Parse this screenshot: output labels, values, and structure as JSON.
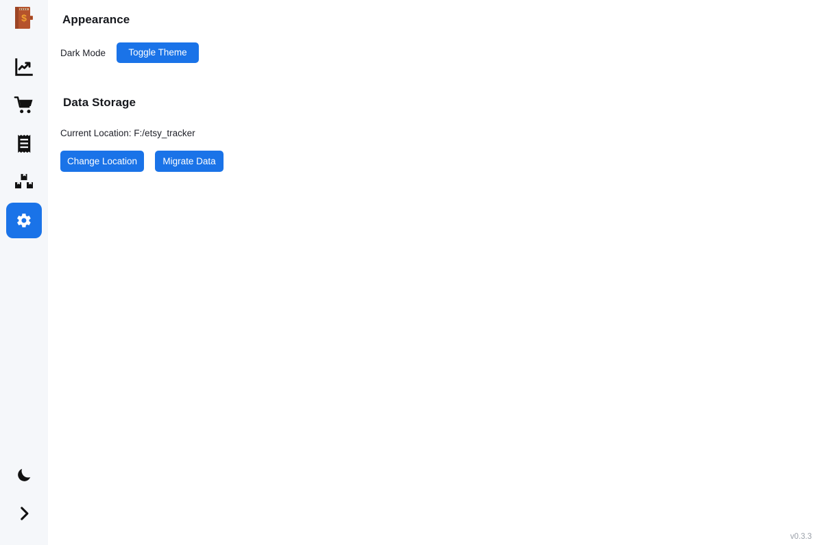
{
  "app": {
    "version_label": "v0.3.3",
    "accent_color": "#1a73e8",
    "sidebar_bg": "#f5f7fa",
    "main_bg": "#ffffff"
  },
  "sidebar": {
    "logo": {
      "icon": "ledger-dollar-icon",
      "alt": "Etsy Tracker logo"
    },
    "items": [
      {
        "icon": "analytics-chart-icon",
        "label": "Analytics",
        "active": false
      },
      {
        "icon": "shopping-cart-icon",
        "label": "Orders",
        "active": false
      },
      {
        "icon": "receipt-icon",
        "label": "Expenses",
        "active": false
      },
      {
        "icon": "boxes-inventory-icon",
        "label": "Inventory",
        "active": false
      },
      {
        "icon": "gear-icon",
        "label": "Settings",
        "active": true
      }
    ],
    "bottom_items": [
      {
        "icon": "moon-icon",
        "label": "Dark mode toggle"
      },
      {
        "icon": "chevron-right-icon",
        "label": "Expand sidebar"
      }
    ]
  },
  "main": {
    "appearance": {
      "title": "Appearance",
      "dark_mode_label": "Dark Mode",
      "toggle_theme_label": "Toggle Theme"
    },
    "data_storage": {
      "title": "Data Storage",
      "current_location_text": "Current Location: F:/etsy_tracker",
      "change_location_label": "Change Location",
      "migrate_data_label": "Migrate Data"
    }
  }
}
